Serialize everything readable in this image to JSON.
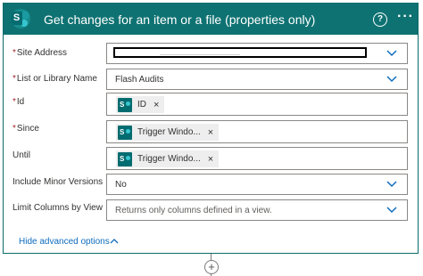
{
  "header": {
    "title": "Get changes for an item or a file (properties only)",
    "connector_icon": "sharepoint-icon",
    "help_symbol": "?",
    "more_symbol": "···",
    "color": "#0f7272"
  },
  "fields": [
    {
      "label": "Site Address",
      "required": true,
      "value": "",
      "masked": true,
      "kind": "dropdown"
    },
    {
      "label": "List or Library Name",
      "required": true,
      "value": "Flash Audits",
      "kind": "dropdown"
    },
    {
      "label": "Id",
      "required": true,
      "token": "ID",
      "kind": "token"
    },
    {
      "label": "Since",
      "required": true,
      "token": "Trigger Windo...",
      "kind": "token"
    },
    {
      "label": "Until",
      "required": false,
      "token": "Trigger Windo...",
      "kind": "token"
    },
    {
      "label": "Include Minor Versions",
      "required": false,
      "value": "No",
      "kind": "dropdown"
    },
    {
      "label": "Limit Columns by View",
      "required": false,
      "placeholder": "Returns only columns defined in a view.",
      "kind": "dropdown"
    }
  ],
  "required_marker": "*",
  "token_remove_symbol": "×",
  "advanced_options_link": "Hide advanced options",
  "add_step_symbol": "+",
  "colors": {
    "accent": "#0f7272",
    "link": "#0f6cbd",
    "chevron": "#0f6cbd",
    "required": "#a4262c"
  }
}
